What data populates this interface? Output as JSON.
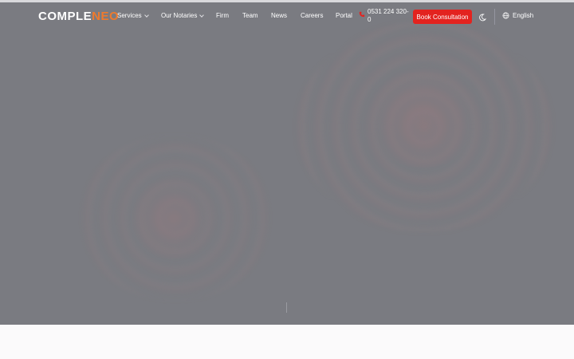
{
  "brand": {
    "logo_text_main": "COMPLE",
    "logo_text_accent": "NEO",
    "accent_color": "#ee7a2d"
  },
  "nav": {
    "items": [
      {
        "label": "Services",
        "has_dropdown": true
      },
      {
        "label": "Our Notaries",
        "has_dropdown": true
      },
      {
        "label": "Firm",
        "has_dropdown": false
      },
      {
        "label": "Team",
        "has_dropdown": false
      },
      {
        "label": "News",
        "has_dropdown": false
      },
      {
        "label": "Careers",
        "has_dropdown": false
      },
      {
        "label": "Portal",
        "has_dropdown": false
      }
    ],
    "phone": "0531 224 320-0",
    "phone_icon": "phone-icon",
    "cta_label": "Book Consultation",
    "cta_color": "#e3231f",
    "theme_icon": "moon-icon",
    "language_icon": "globe-icon",
    "language_label": "English"
  },
  "hero": {
    "background_color": "#7a7b81"
  }
}
